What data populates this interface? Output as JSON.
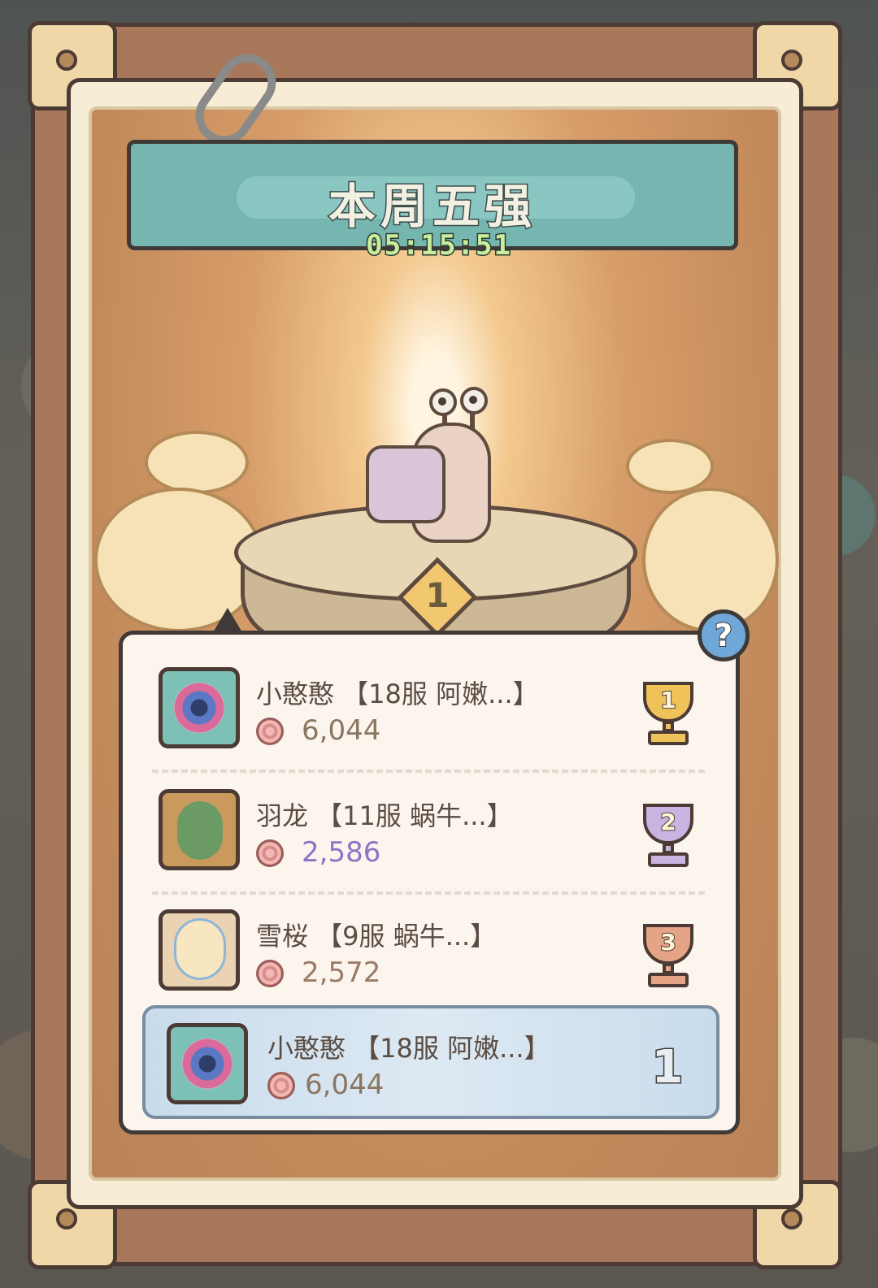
{
  "header": {
    "title": "本周五强",
    "timer": "05:15:51"
  },
  "podium": {
    "rank_number": "1"
  },
  "help": {
    "label": "?"
  },
  "rankings": [
    {
      "name": "小憨憨 【18服 阿嫩...】",
      "score": "6,044",
      "score_color": "#8a7660",
      "rank": "1",
      "trophy_color": "#f0c35a"
    },
    {
      "name": "羽龙 【11服 蜗牛...】",
      "score": "2,586",
      "score_color": "#8a74c6",
      "rank": "2",
      "trophy_color": "#c9b3e0"
    },
    {
      "name": "雪桜 【9服 蜗牛...】",
      "score": "2,572",
      "score_color": "#9a7a66",
      "rank": "3",
      "trophy_color": "#e5a486"
    }
  ],
  "my_rank": {
    "name": "小憨憨 【18服 阿嫩...】",
    "score": "6,044",
    "rank": "1"
  },
  "icons": {
    "clip": "paper-clip-icon",
    "help": "question-mark-icon",
    "currency": "snail-shell-icon",
    "trophy": "trophy-icon"
  }
}
